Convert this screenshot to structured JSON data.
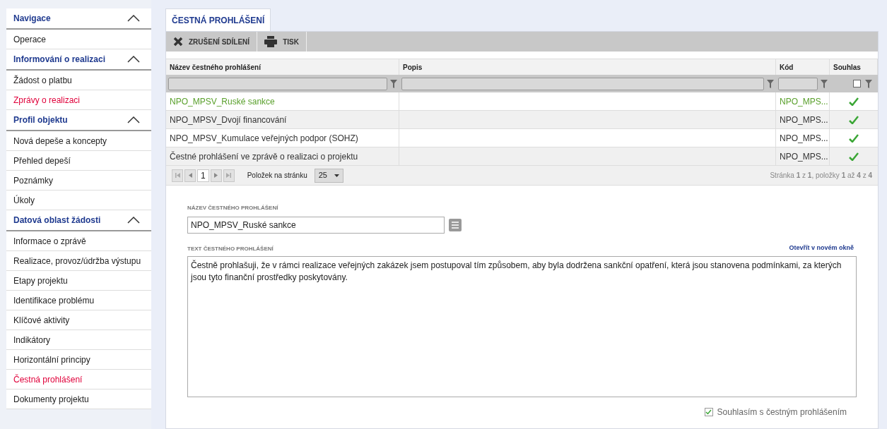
{
  "sidebar": [
    {
      "kind": "header",
      "label": "Navigace",
      "expanded": true
    },
    {
      "kind": "item",
      "label": "Operace",
      "selected": false
    },
    {
      "kind": "header",
      "label": "Informování o realizaci",
      "expanded": true
    },
    {
      "kind": "item",
      "label": "Žádost o platbu",
      "selected": false
    },
    {
      "kind": "item",
      "label": "Zprávy o realizaci",
      "selected": true
    },
    {
      "kind": "header",
      "label": "Profil objektu",
      "expanded": true
    },
    {
      "kind": "item",
      "label": "Nová depeše a koncepty",
      "selected": false
    },
    {
      "kind": "item",
      "label": "Přehled depeší",
      "selected": false
    },
    {
      "kind": "item",
      "label": "Poznámky",
      "selected": false
    },
    {
      "kind": "item",
      "label": "Úkoly",
      "selected": false
    },
    {
      "kind": "header",
      "label": "Datová oblast žádosti",
      "expanded": true
    },
    {
      "kind": "item",
      "label": "Informace o zprávě",
      "selected": false
    },
    {
      "kind": "item",
      "label": "Realizace, provoz/údržba výstupu",
      "selected": false
    },
    {
      "kind": "item",
      "label": "Etapy projektu",
      "selected": false
    },
    {
      "kind": "item",
      "label": "Identifikace problému",
      "selected": false
    },
    {
      "kind": "item",
      "label": "Klíčové aktivity",
      "selected": false
    },
    {
      "kind": "item",
      "label": "Indikátory",
      "selected": false
    },
    {
      "kind": "item",
      "label": "Horizontální principy",
      "selected": false
    },
    {
      "kind": "item",
      "label": "Čestná prohlášení",
      "selected": true
    },
    {
      "kind": "item",
      "label": "Dokumenty projektu",
      "selected": false
    }
  ],
  "tab": {
    "label": "ČESTNÁ PROHLÁŠENÍ",
    "selected": true
  },
  "toolbar": [
    {
      "kind": "cancel",
      "label": "ZRUŠENÍ SDÍLENÍ"
    },
    {
      "kind": "print",
      "label": "TISK"
    }
  ],
  "table": {
    "columns": [
      "Název čestného prohlášení",
      "Popis",
      "Kód",
      "Souhlas"
    ],
    "filter_checked": false,
    "rows": [
      {
        "name": "NPO_MPSV_Ruské sankce",
        "code": "NPO_MPS...",
        "agreed": true,
        "selected": true
      },
      {
        "name": "NPO_MPSV_Dvojí financování",
        "code": "NPO_MPS...",
        "agreed": true,
        "selected": false
      },
      {
        "name": "NPO_MPSV_Kumulace veřejných podpor (SOHZ)",
        "code": "NPO_MPS...",
        "agreed": true,
        "selected": false
      },
      {
        "name": "Čestné prohlášení ve zprávě o realizaci o projektu",
        "code": "NPO_MPS...",
        "agreed": true,
        "selected": false
      }
    ]
  },
  "pager": {
    "page": "1",
    "page_size_label": "Položek na stránku",
    "page_size": "25",
    "info": "Stránka **1** z **1**, položky **1** až **4** z **4**"
  },
  "detail": {
    "name_label": "NÁZEV ČESTNÉHO PROHLÁŠENÍ",
    "name_value": "NPO_MPSV_Ruské sankce",
    "text_label": "TEXT ČESTNÉHO PROHLÁŠENÍ",
    "open_link": "Otevřít v novém okně",
    "text_value": "Čestně prohlašuji, že v rámci realizace veřejných zakázek jsem postupoval tím způsobem, aby byla dodržena sankční opatření, která jsou stanovena podmínkami, za kterých jsou tyto finanční prostředky poskytovány.",
    "agree_label": "Souhlasím s čestným prohlášením",
    "agree_checked": true
  }
}
